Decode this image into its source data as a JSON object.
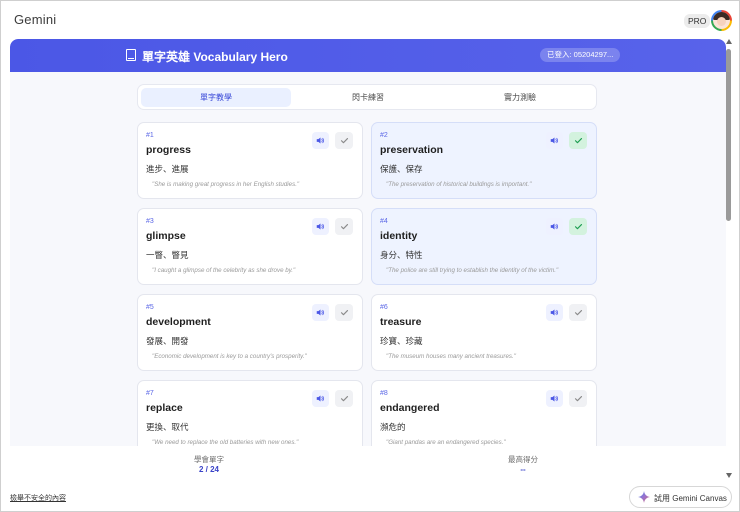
{
  "app": {
    "title": "Gemini",
    "pro_badge": "PRO"
  },
  "hero": {
    "title": "單字英雄 Vocabulary Hero",
    "login": "已登入: 05204297..."
  },
  "tabs": [
    {
      "label": "單字教學",
      "active": true
    },
    {
      "label": "閃卡練習",
      "active": false
    },
    {
      "label": "實力測驗",
      "active": false
    }
  ],
  "cards": [
    {
      "num": "#1",
      "word": "progress",
      "zh": "進步、進展",
      "example": "\"She is making great progress in her English studies.\"",
      "learned": false
    },
    {
      "num": "#2",
      "word": "preservation",
      "zh": "保護、保存",
      "example": "\"The preservation of historical buildings is important.\"",
      "learned": true
    },
    {
      "num": "#3",
      "word": "glimpse",
      "zh": "一瞥、瞥見",
      "example": "\"I caught a glimpse of the celebrity as she drove by.\"",
      "learned": false
    },
    {
      "num": "#4",
      "word": "identity",
      "zh": "身分、特性",
      "example": "\"The police are still trying to establish the identity of the victim.\"",
      "learned": true
    },
    {
      "num": "#5",
      "word": "development",
      "zh": "發展、開發",
      "example": "\"Economic development is key to a country's prosperity.\"",
      "learned": false
    },
    {
      "num": "#6",
      "word": "treasure",
      "zh": "珍寶、珍藏",
      "example": "\"The museum houses many ancient treasures.\"",
      "learned": false
    },
    {
      "num": "#7",
      "word": "replace",
      "zh": "更換、取代",
      "example": "\"We need to replace the old batteries with new ones.\"",
      "learned": false
    },
    {
      "num": "#8",
      "word": "endangered",
      "zh": "瀕危的",
      "example": "\"Giant pandas are an endangered species.\"",
      "learned": false
    }
  ],
  "stats": {
    "learned_label": "學會單字",
    "learned_value": "2 / 24",
    "best_label": "最高得分",
    "best_value": "--"
  },
  "footer": {
    "unsafe_link": "檢舉不安全的內容",
    "canvas_button": "試用 Gemini Canvas"
  },
  "colors": {
    "accent": "#4b57e6",
    "learned_card": "#eef3ff",
    "check_on": "#d3f2de"
  },
  "icons": {
    "sound": "speaker-icon",
    "check": "check-icon",
    "book": "book-icon",
    "sparkle": "sparkle-icon"
  }
}
